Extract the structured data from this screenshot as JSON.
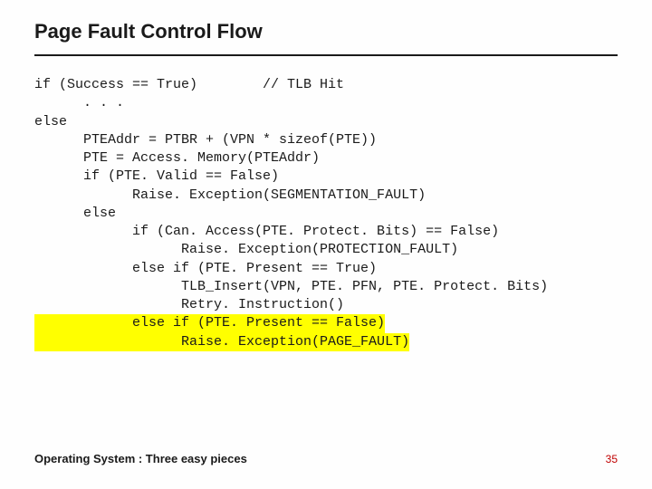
{
  "slide": {
    "title": "Page Fault Control Flow",
    "footer_title": "Operating System : Three easy pieces",
    "page_number": "35"
  },
  "code": {
    "lines": [
      {
        "text": "if (Success == True)        // TLB Hit",
        "hl": false
      },
      {
        "text": "      . . .",
        "hl": false
      },
      {
        "text": "else",
        "hl": false
      },
      {
        "text": "      PTEAddr = PTBR + (VPN * sizeof(PTE))",
        "hl": false
      },
      {
        "text": "      PTE = Access. Memory(PTEAddr)",
        "hl": false
      },
      {
        "text": "      if (PTE. Valid == False)",
        "hl": false
      },
      {
        "text": "            Raise. Exception(SEGMENTATION_FAULT)",
        "hl": false
      },
      {
        "text": "      else",
        "hl": false
      },
      {
        "text": "            if (Can. Access(PTE. Protect. Bits) == False)",
        "hl": false
      },
      {
        "text": "                  Raise. Exception(PROTECTION_FAULT)",
        "hl": false
      },
      {
        "text": "            else if (PTE. Present == True)",
        "hl": false
      },
      {
        "text": "                  TLB_Insert(VPN, PTE. PFN, PTE. Protect. Bits)",
        "hl": false
      },
      {
        "text": "                  Retry. Instruction()",
        "hl": false
      },
      {
        "text": "            else if (PTE. Present == False)",
        "hl": true
      },
      {
        "text": "                  Raise. Exception(PAGE_FAULT)",
        "hl": true
      }
    ]
  }
}
